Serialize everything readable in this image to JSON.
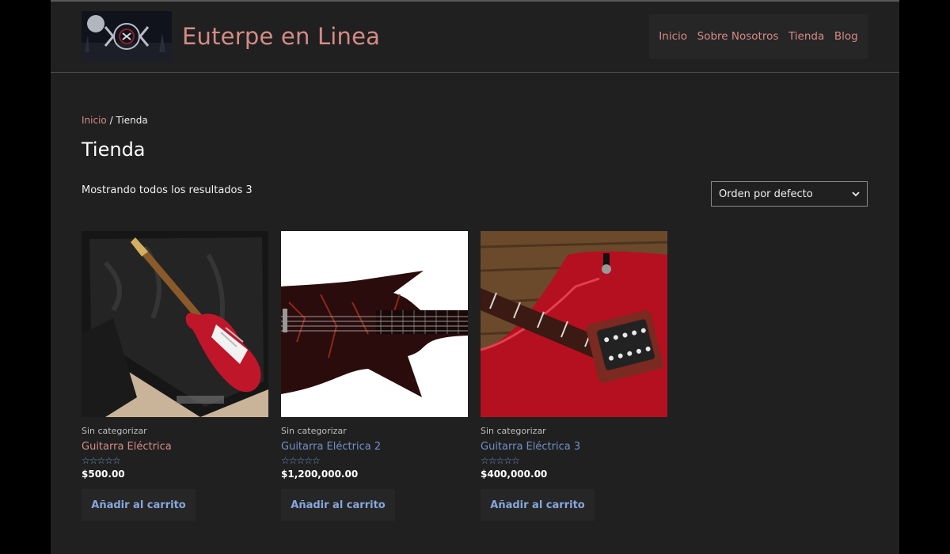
{
  "site": {
    "title": "Euterpe en Linea"
  },
  "nav": {
    "items": [
      "Inicio",
      "Sobre Nosotros",
      "Tienda",
      "Blog"
    ]
  },
  "breadcrumb": {
    "home": "Inicio",
    "separator": " / ",
    "current": "Tienda"
  },
  "page": {
    "title": "Tienda",
    "result_count": "Mostrando todos los resultados 3"
  },
  "ordering": {
    "selected": "Orden por defecto"
  },
  "colors": {
    "accent": "#d58b86",
    "link": "#7092c8",
    "button_text": "#87a7de",
    "background": "#202020"
  },
  "products": [
    {
      "category": "Sin categorizar",
      "name": "Guitarra Eléctrica",
      "name_color": "#d58b86",
      "rating": "☆☆☆☆☆",
      "price": "$500.00",
      "button": "Añadir al carrito"
    },
    {
      "category": "Sin categorizar",
      "name": "Guitarra Eléctrica 2",
      "name_color": "#7092c8",
      "rating": "☆☆☆☆☆",
      "price": "$1,200,000.00",
      "button": "Añadir al carrito"
    },
    {
      "category": "Sin categorizar",
      "name": "Guitarra Eléctrica 3",
      "name_color": "#7092c8",
      "rating": "☆☆☆☆☆",
      "price": "$400,000.00",
      "button": "Añadir al carrito"
    }
  ]
}
